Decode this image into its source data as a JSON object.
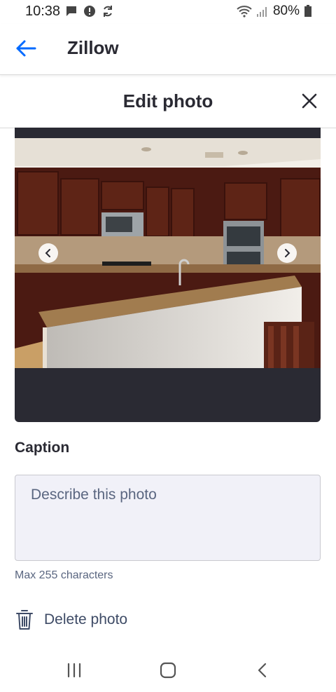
{
  "status_bar": {
    "time": "10:38",
    "battery": "80%",
    "icons": [
      "message-icon",
      "alert-icon",
      "sync-icon",
      "wifi-icon",
      "signal-icon",
      "battery-icon"
    ]
  },
  "app_bar": {
    "back_icon": "arrow-left-icon",
    "title": "Zillow",
    "accent_color": "#006aff"
  },
  "dialog": {
    "title": "Edit photo",
    "close_icon": "close-icon"
  },
  "photo": {
    "prev_icon": "chevron-left-icon",
    "next_icon": "chevron-right-icon"
  },
  "caption": {
    "label": "Caption",
    "value": "",
    "placeholder": "Describe this photo",
    "hint": "Max 255 characters"
  },
  "delete": {
    "icon": "trash-icon",
    "label": "Delete photo"
  },
  "nav_bar": {
    "icons": [
      "recent-apps-icon",
      "home-icon",
      "back-icon"
    ]
  }
}
